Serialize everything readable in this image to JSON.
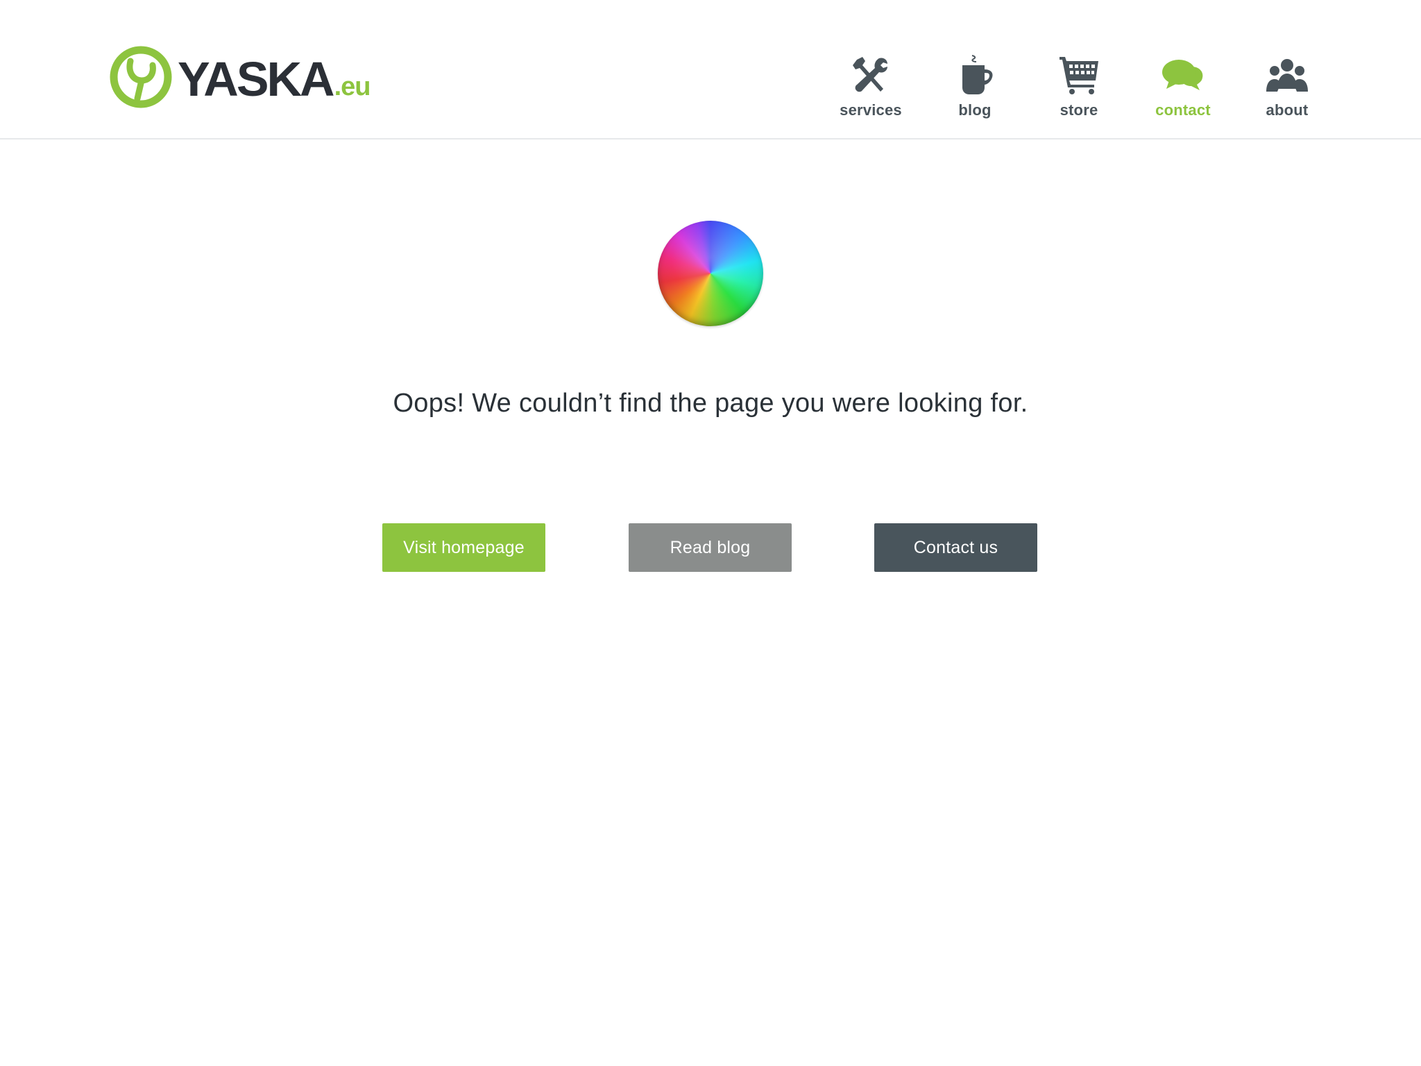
{
  "brand": {
    "name": "YASKA",
    "tld": ".eu",
    "accent_color": "#8dc43f",
    "dark_color": "#2b2f36"
  },
  "nav": {
    "items": [
      {
        "label": "services",
        "icon": "tools-icon",
        "active": false
      },
      {
        "label": "blog",
        "icon": "coffee-cup-icon",
        "active": false
      },
      {
        "label": "store",
        "icon": "shopping-cart-icon",
        "active": false
      },
      {
        "label": "contact",
        "icon": "chat-bubbles-icon",
        "active": true
      },
      {
        "label": "about",
        "icon": "people-icon",
        "active": false
      }
    ]
  },
  "main": {
    "spinner_icon": "rainbow-spinner-icon",
    "message": "Oops! We couldn’t find the page you were looking for.",
    "buttons": {
      "home": {
        "label": "Visit homepage",
        "color": "#8dc43f"
      },
      "blog": {
        "label": "Read blog",
        "color": "#8a8d8c"
      },
      "contact": {
        "label": "Contact us",
        "color": "#49555c"
      }
    }
  }
}
